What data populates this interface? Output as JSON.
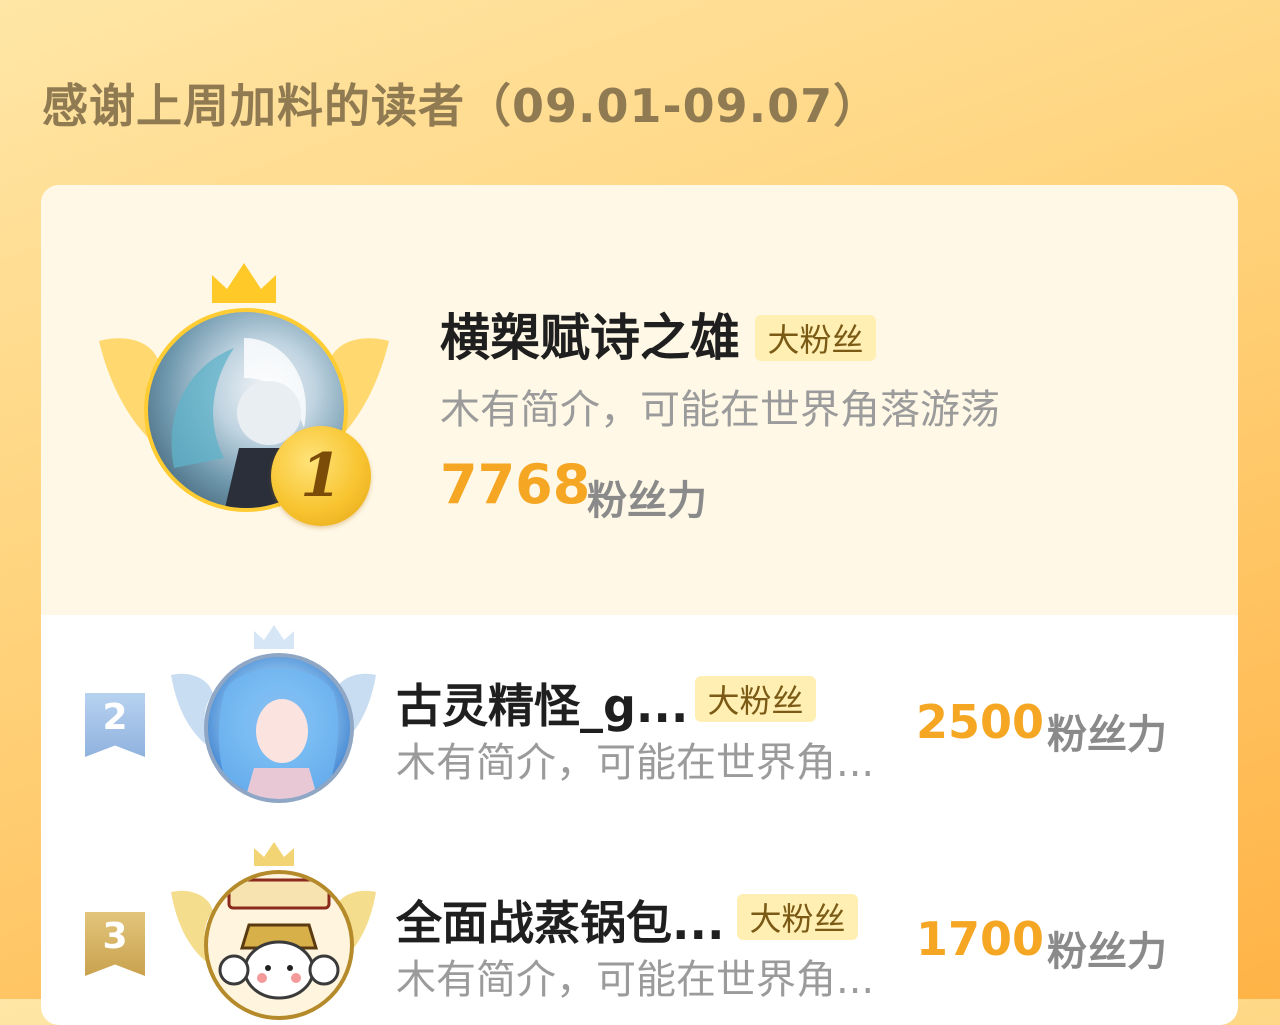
{
  "page": {
    "title": "感谢上周加料的读者（09.01-09.07）"
  },
  "colors": {
    "accent": "#f5a623",
    "badge_bg": "#ffefb3",
    "gold": "#f8c531",
    "silver": "#a9c6e8",
    "bronze": "#d8b56a"
  },
  "top_reader": {
    "rank": "1",
    "name": "横槊赋诗之雄",
    "badge": "大粉丝",
    "bio": "木有简介，可能在世界角落游荡",
    "score": "7768",
    "score_unit": "粉丝力"
  },
  "readers": [
    {
      "rank": "2",
      "name": "古灵精怪_g...",
      "badge": "大粉丝",
      "bio": "木有简介，可能在世界角...",
      "score": "2500",
      "score_unit": "粉丝力"
    },
    {
      "rank": "3",
      "name": "全面战蒸锅包...",
      "badge": "大粉丝",
      "bio": "木有简介，可能在世界角...",
      "score": "1700",
      "score_unit": "粉丝力"
    }
  ]
}
